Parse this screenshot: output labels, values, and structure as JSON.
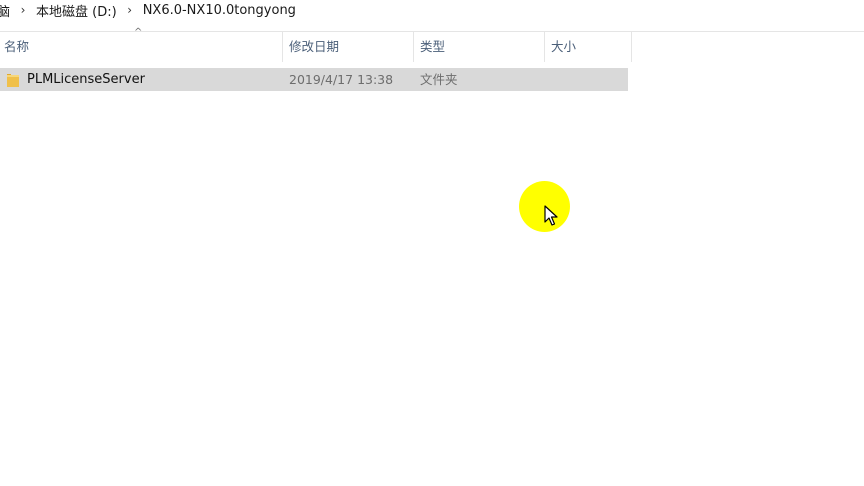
{
  "breadcrumb": {
    "items": [
      {
        "label": "脑"
      },
      {
        "label": "本地磁盘 (D:)"
      },
      {
        "label": "NX6.0-NX10.0tongyong"
      }
    ]
  },
  "columns": {
    "name": "名称",
    "date_modified": "修改日期",
    "type": "类型",
    "size": "大小",
    "sort_indicator": "^"
  },
  "files": [
    {
      "name": "PLMLicenseServer",
      "date_modified": "2019/4/17 13:38",
      "type": "文件夹",
      "icon": "folder-icon"
    }
  ],
  "colors": {
    "selected_row": "#d9d9d9",
    "header_text": "#4c607a",
    "folder": "#f0c04a",
    "cursor_highlight": "#ffff00"
  }
}
